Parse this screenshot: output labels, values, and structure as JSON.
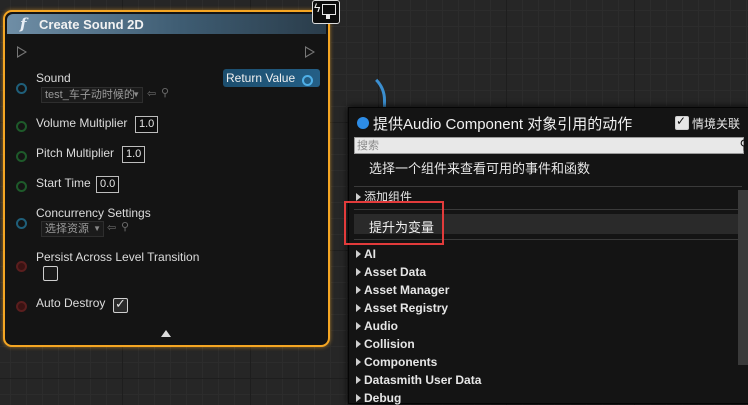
{
  "node": {
    "title": "Create Sound 2D",
    "return_label": "Return Value",
    "pins": {
      "sound": {
        "label": "Sound",
        "asset": "test_车子动时候的"
      },
      "volume": {
        "label": "Volume Multiplier",
        "value": "1.0"
      },
      "pitch": {
        "label": "Pitch Multiplier",
        "value": "1.0"
      },
      "start_time": {
        "label": "Start Time",
        "value": "0.0"
      },
      "concurrency": {
        "label": "Concurrency Settings",
        "asset": "选择资源"
      },
      "persist": {
        "label": "Persist Across Level Transition",
        "checked": false
      },
      "auto_destroy": {
        "label": "Auto Destroy",
        "checked": true
      }
    }
  },
  "menu": {
    "title": "提供Audio Component 对象引用的动作",
    "context_label": "情境关联",
    "search_placeholder": "搜索",
    "hint": "选择一个组件来查看可用的事件和函数",
    "add_component": "添加组件",
    "promote_to_variable": "提升为变量",
    "categories": [
      "AI",
      "Asset Data",
      "Asset Manager",
      "Asset Registry",
      "Audio",
      "Collision",
      "Components",
      "Datasmith User Data",
      "Debug"
    ]
  },
  "colors": {
    "node_border": "#f5a623",
    "header_start": "#6f8ea6",
    "wire": "#3b8fd0",
    "accent_dot": "#2d8ce6",
    "highlight": "#e23b3b"
  }
}
